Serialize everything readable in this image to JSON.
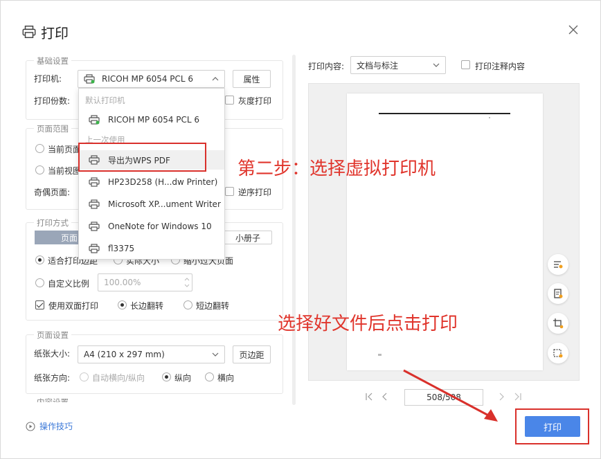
{
  "dialog": {
    "title": "打印"
  },
  "sections": {
    "basic": "基础设置",
    "range": "页面范围",
    "method": "打印方式",
    "page_setup": "页面设置",
    "content": "内容设置"
  },
  "basic": {
    "printer_label": "打印机:",
    "printer_value": "RICOH MP 6054 PCL 6",
    "properties_button": "属性",
    "copies_label": "打印份数:",
    "grayscale_label": "灰度打印"
  },
  "range": {
    "current_page": "当前页面",
    "current_view": "当前视图",
    "odd_even_label": "奇偶页面:",
    "reverse_label": "逆序打印"
  },
  "method": {
    "seg_button": "页面",
    "booklet_button": "小册子",
    "fit_label": "适合打印边距",
    "actual_size": "实际大小",
    "shrink_oversize": "缩小过大页面",
    "custom_scale": "自定义比例",
    "scale_value": "100.00%",
    "duplex_label": "使用双面打印",
    "long_edge": "长边翻转",
    "short_edge": "短边翻转"
  },
  "page_setup": {
    "paper_size_label": "纸张大小:",
    "paper_size_value": "A4 (210 x 297 mm)",
    "margins_button": "页边距",
    "orientation_label": "纸张方向:",
    "auto": "自动横向/纵向",
    "portrait": "纵向",
    "landscape": "横向"
  },
  "dropdown": {
    "group_default": "默认打印机",
    "group_recent": "上一次使用",
    "items": [
      "RICOH MP 6054 PCL 6",
      "导出为WPS PDF",
      "HP23D258 (H...dw Printer)",
      "Microsoft XP...ument Writer",
      "OneNote for Windows 10",
      "fl3375"
    ]
  },
  "preview": {
    "content_label": "打印内容:",
    "content_value": "文档与标注",
    "annotation_label": "打印注释内容",
    "page_indicator": "508/508"
  },
  "footer": {
    "tips_link": "操作技巧",
    "print_button": "打印"
  },
  "annotations": {
    "step2": "第二步：选择虚拟打印机",
    "after_select": "选择好文件后点击打印"
  },
  "colors": {
    "accent": "#4a86e8",
    "annotation_red": "#e0352c",
    "link": "#3b78d8"
  }
}
